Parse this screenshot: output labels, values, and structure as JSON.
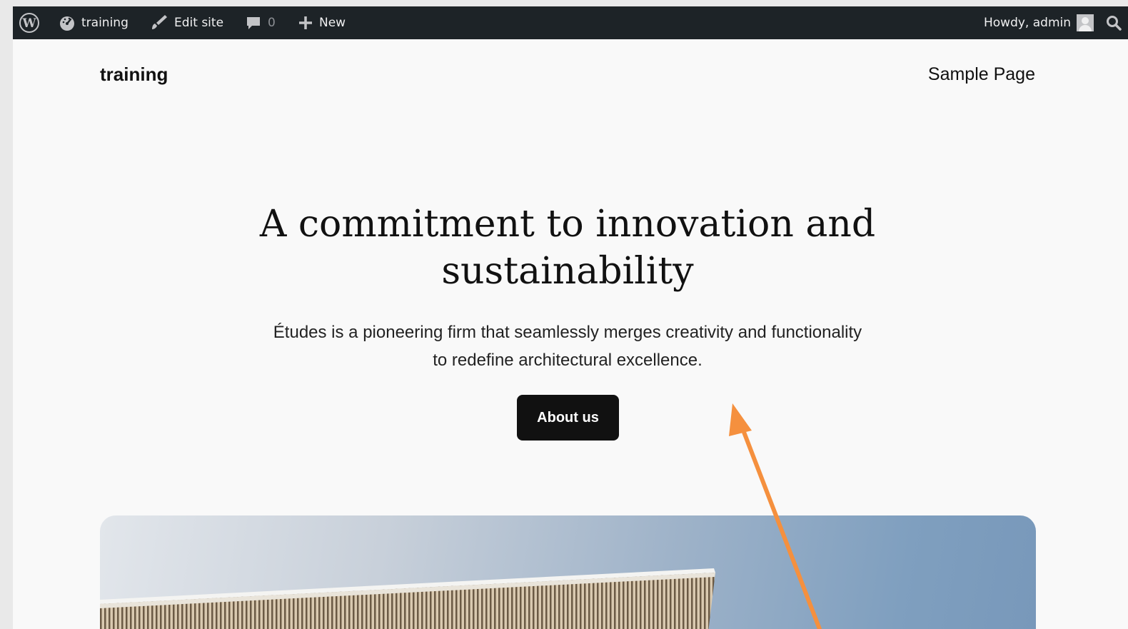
{
  "adminbar": {
    "site_name": "training",
    "edit_site": "Edit site",
    "comments_count": "0",
    "new_label": "New",
    "greeting": "Howdy, admin"
  },
  "site": {
    "title": "training",
    "nav": [
      "Sample Page"
    ]
  },
  "hero": {
    "heading": "A commitment to innovation and sustainability",
    "text": "Études is a pioneering firm that seamlessly merges creativity and functionality to redefine architectural excellence.",
    "button_label": "About us"
  },
  "colors": {
    "adminbar_bg": "#1d2327",
    "page_bg": "#f9f9f9",
    "button_bg": "#111111",
    "annotation_arrow": "#f5903e"
  },
  "icons": {
    "wordpress_logo": "wordpress-logo-icon",
    "dashboard": "dashboard-icon",
    "edit_site": "brush-icon",
    "comments": "comment-icon",
    "new": "plus-icon",
    "search": "search-icon"
  }
}
